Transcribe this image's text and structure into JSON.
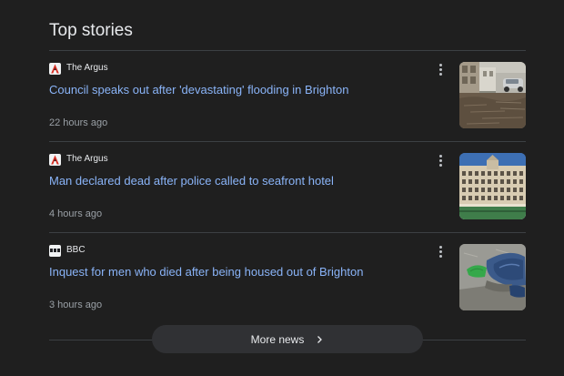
{
  "section": {
    "title": "Top stories"
  },
  "stories": [
    {
      "source": "The Argus",
      "source_icon": "the-argus-logo",
      "headline": "Council speaks out after 'devastating' flooding in Brighton",
      "time": "22 hours ago",
      "thumbnail": "flooded-street-photo"
    },
    {
      "source": "The Argus",
      "source_icon": "the-argus-logo",
      "headline": "Man declared dead after police called to seafront hotel",
      "time": "4 hours ago",
      "thumbnail": "seafront-hotel-photo"
    },
    {
      "source": "BBC",
      "source_icon": "bbc-logo",
      "headline": "Inquest for men who died after being housed out of Brighton",
      "time": "3 hours ago",
      "thumbnail": "rough-sleeper-belongings-photo"
    }
  ],
  "more_news": {
    "label": "More news",
    "icon": "chevron-right-icon"
  },
  "colors": {
    "background": "#1f1f1f",
    "headline_link": "#8ab4f8",
    "secondary_text": "#9aa0a6",
    "divider": "#3c4043",
    "button_bg": "#303134"
  }
}
